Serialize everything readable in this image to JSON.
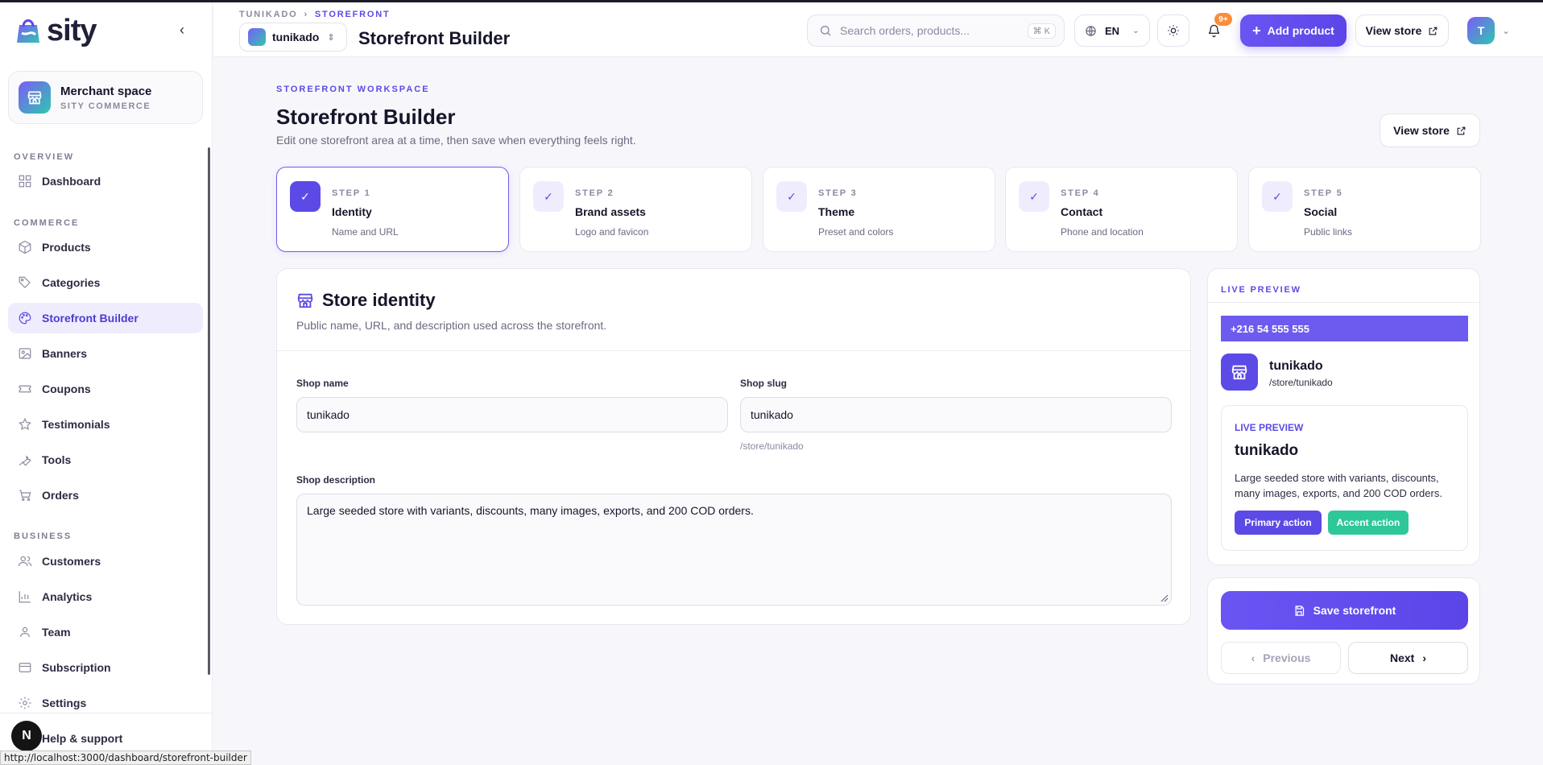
{
  "app": {
    "brand": "sity",
    "status_url": "http://localhost:3000/dashboard/storefront-builder"
  },
  "sidebar": {
    "merchant": {
      "name": "Merchant space",
      "subtitle": "SITY COMMERCE"
    },
    "sections": [
      {
        "label": "OVERVIEW",
        "items": [
          {
            "label": "Dashboard",
            "icon": "grid-icon"
          }
        ]
      },
      {
        "label": "COMMERCE",
        "items": [
          {
            "label": "Products",
            "icon": "box-icon"
          },
          {
            "label": "Categories",
            "icon": "tag-icon"
          },
          {
            "label": "Storefront Builder",
            "icon": "palette-icon",
            "active": true
          },
          {
            "label": "Banners",
            "icon": "image-icon"
          },
          {
            "label": "Coupons",
            "icon": "ticket-icon"
          },
          {
            "label": "Testimonials",
            "icon": "star-icon"
          },
          {
            "label": "Tools",
            "icon": "wrench-icon"
          },
          {
            "label": "Orders",
            "icon": "cart-icon"
          }
        ]
      },
      {
        "label": "BUSINESS",
        "items": [
          {
            "label": "Customers",
            "icon": "users-icon"
          },
          {
            "label": "Analytics",
            "icon": "chart-icon"
          },
          {
            "label": "Team",
            "icon": "team-icon"
          },
          {
            "label": "Subscription",
            "icon": "card-icon"
          },
          {
            "label": "Settings",
            "icon": "gear-icon"
          },
          {
            "label": "Help & support",
            "icon": "help-icon"
          }
        ]
      }
    ]
  },
  "header": {
    "breadcrumb": [
      "TUNIKADO",
      "STOREFRONT"
    ],
    "store_name": "tunikado",
    "title": "Storefront Builder",
    "search_placeholder": "Search orders, products...",
    "search_shortcut": "⌘ K",
    "language": "EN",
    "notifications_badge": "9+",
    "add_product_label": "Add product",
    "view_store_label": "View store",
    "avatar_initial": "T"
  },
  "page": {
    "eyebrow": "STOREFRONT WORKSPACE",
    "title": "Storefront Builder",
    "subtitle": "Edit one storefront area at a time, then save when everything feels right.",
    "view_store_label": "View store"
  },
  "steps": [
    {
      "num": "STEP 1",
      "title": "Identity",
      "sub": "Name and URL",
      "active": true
    },
    {
      "num": "STEP 2",
      "title": "Brand assets",
      "sub": "Logo and favicon"
    },
    {
      "num": "STEP 3",
      "title": "Theme",
      "sub": "Preset and colors"
    },
    {
      "num": "STEP 4",
      "title": "Contact",
      "sub": "Phone and location"
    },
    {
      "num": "STEP 5",
      "title": "Social",
      "sub": "Public links"
    }
  ],
  "identity": {
    "title": "Store identity",
    "subtitle": "Public name, URL, and description used across the storefront.",
    "shop_name_label": "Shop name",
    "shop_name_value": "tunikado",
    "shop_slug_label": "Shop slug",
    "shop_slug_value": "tunikado",
    "slug_hint": "/store/tunikado",
    "description_label": "Shop description",
    "description_value": "Large seeded store with variants, discounts, many images, exports, and 200 COD orders."
  },
  "preview": {
    "head": "LIVE PREVIEW",
    "phone": "+216 54 555 555",
    "store_name": "tunikado",
    "store_path": "/store/tunikado",
    "inner_head": "LIVE PREVIEW",
    "inner_name": "tunikado",
    "inner_desc": "Large seeded store with variants, discounts, many images, exports, and 200 COD orders.",
    "primary_action": "Primary action",
    "accent_action": "Accent action",
    "primary_color": "#5b4ae6",
    "accent_color": "#2ec79a"
  },
  "actions": {
    "save_label": "Save storefront",
    "previous_label": "Previous",
    "next_label": "Next"
  }
}
